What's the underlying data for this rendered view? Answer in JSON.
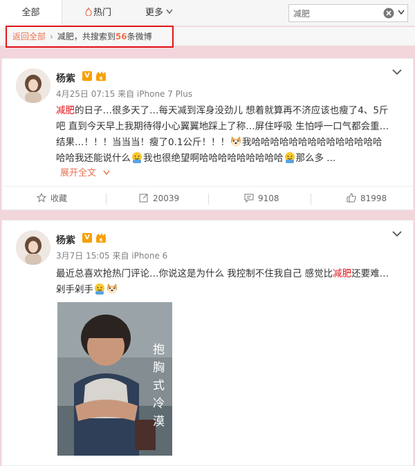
{
  "tabs": {
    "all": "全部",
    "hot": "热门",
    "more": "更多"
  },
  "search": {
    "value": "减肥"
  },
  "result": {
    "back": "返回全部",
    "keyword": "减肥",
    "prefix": "，共搜索到",
    "count": "56",
    "suffix": "条微博"
  },
  "posts": [
    {
      "username": "杨紫",
      "meta": "4月25日 07:15 来自 iPhone 7 Plus",
      "lines": [
        {
          "hl": "减肥",
          "text": "的日子…很多天了…每天减到浑身没劲儿 想着就算再不济应该也瘦了4、5斤"
        },
        {
          "text": "吧 直到今天早上我期待得小心翼翼地踩上了称…屏住呼吸 生怕呼一口气都会重…"
        },
        {
          "text": "结果…！！！当当当！瘦了0.1公斤！！！",
          "tail": "我哈哈哈哈哈哈哈哈哈哈哈哈哈哈"
        },
        {
          "a": "哈哈我还能说什么",
          "b": "我也很绝望啊哈哈哈哈哈哈哈哈哈",
          "c": "那么多 ..."
        }
      ],
      "expand": "展开全文",
      "actions": {
        "favorite": "收藏",
        "repost": "20039",
        "comment": "9108",
        "like": "81998"
      }
    },
    {
      "username": "杨紫",
      "meta": "3月7日 15:05 来自 iPhone 6",
      "line1_a": "最近总喜欢抢热门评论…你说这是为什么 我控制不住我自己 感觉比",
      "line1_hl": "减肥",
      "line1_b": "还要难…",
      "line2": "剁手剁手",
      "photo_caption": "抱胸式冷漠"
    }
  ],
  "colors": {
    "accent": "#eb7350",
    "highlight": "#e0161b",
    "frame": "#e0161b",
    "background": "#f2d6dc"
  }
}
